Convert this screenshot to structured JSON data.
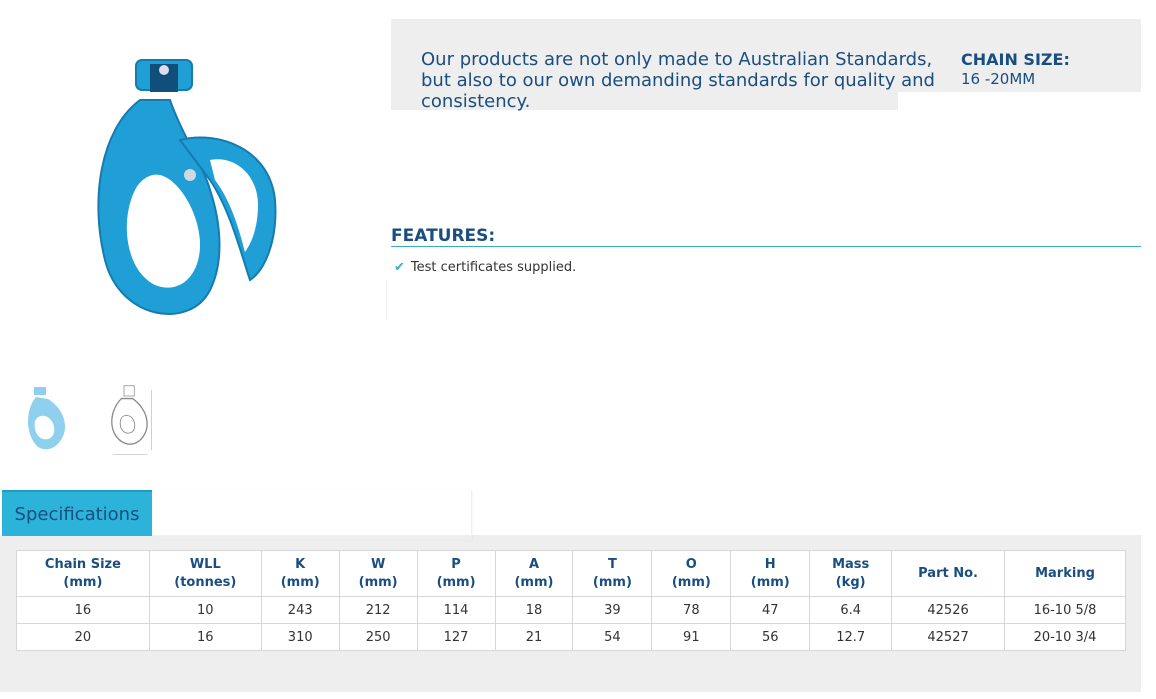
{
  "product": {
    "intro": "Our products are not only made to Australian Standards, but also to our own demanding standards for quality and consistency.",
    "chain_size_label": "CHAIN SIZE:",
    "chain_size_value": "16 -20MM"
  },
  "features": {
    "title": "FEATURES:",
    "items": [
      "Test certificates supplied."
    ]
  },
  "icons": {
    "check": "check-icon",
    "main_image": "clevis-hook-image",
    "thumb_photo": "hook-photo-thumbnail",
    "thumb_drawing": "hook-drawing-thumbnail"
  },
  "colors": {
    "brand_blue": "#1a4e80",
    "accent": "#2bb3da",
    "hook_blue": "#1f9fd6"
  },
  "specs": {
    "tab_label": "Specifications",
    "headers": [
      [
        "Chain Size",
        "(mm)"
      ],
      [
        "WLL",
        "(tonnes)"
      ],
      [
        "K",
        "(mm)"
      ],
      [
        "W",
        "(mm)"
      ],
      [
        "P",
        "(mm)"
      ],
      [
        "A",
        "(mm)"
      ],
      [
        "T",
        "(mm)"
      ],
      [
        "O",
        "(mm)"
      ],
      [
        "H",
        "(mm)"
      ],
      [
        "Mass",
        "(kg)"
      ],
      [
        "Part No.",
        ""
      ],
      [
        "Marking",
        ""
      ]
    ],
    "rows": [
      [
        "16",
        "10",
        "243",
        "212",
        "114",
        "18",
        "39",
        "78",
        "47",
        "6.4",
        "42526",
        "16-10 5/8"
      ],
      [
        "20",
        "16",
        "310",
        "250",
        "127",
        "21",
        "54",
        "91",
        "56",
        "12.7",
        "42527",
        "20-10 3/4"
      ]
    ]
  }
}
